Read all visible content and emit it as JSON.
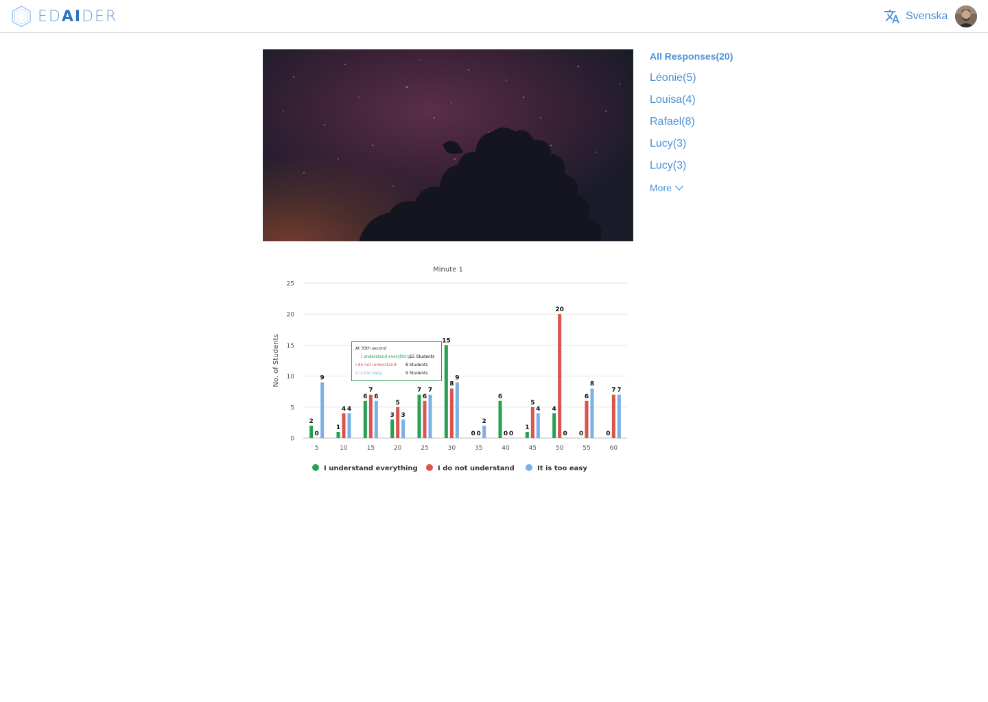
{
  "header": {
    "logo": {
      "pre": "ED",
      "ai": "AI",
      "post": "DER"
    },
    "language": "Svenska",
    "language_icon": "translate-icon",
    "avatar_icon": "user-avatar"
  },
  "sidebar": {
    "all_responses": "All Responses(20)",
    "items": [
      "Léonie(5)",
      "Louisa(4)",
      "Rafael(8)",
      "Lucy(3)",
      "Lucy(3)"
    ],
    "more": "More",
    "more_icon": "chevron-down-icon"
  },
  "colors": {
    "accent": "#4a90d9",
    "green": "#27a052",
    "red": "#d9534f",
    "blue": "#7ab0e6"
  },
  "tooltip": {
    "title": "At 30th second",
    "rows": [
      {
        "label": "I understand everything:",
        "value": "15 Students"
      },
      {
        "label": "I do not understand:",
        "value": "8 Students"
      },
      {
        "label": "It is too easy:",
        "value": "9 Students"
      }
    ]
  },
  "chart_data": {
    "type": "bar",
    "title": "Minute 1",
    "ylabel": "No. of Students",
    "xlabel": "",
    "ylim": [
      0,
      25
    ],
    "yticks": [
      0,
      5,
      10,
      15,
      20,
      25
    ],
    "categories": [
      "5",
      "10",
      "15",
      "20",
      "25",
      "30",
      "35",
      "40",
      "45",
      "50",
      "55",
      "60"
    ],
    "series": [
      {
        "name": "I understand everything",
        "color": "#27a052",
        "values": [
          2,
          1,
          6,
          3,
          7,
          15,
          0,
          6,
          1,
          4,
          null,
          null
        ]
      },
      {
        "name": "I do not understand",
        "color": "#d9534f",
        "values": [
          0,
          4,
          7,
          5,
          6,
          8,
          0,
          0,
          5,
          20,
          6,
          7
        ]
      },
      {
        "name": "It is too easy",
        "color": "#7ab0e6",
        "values": [
          9,
          4,
          6,
          3,
          7,
          9,
          2,
          0,
          4,
          0,
          8,
          7
        ]
      }
    ],
    "extra_labels": [
      {
        "category": "55",
        "series": 0,
        "text": "0"
      },
      {
        "category": "60",
        "series": 0,
        "text": "0"
      }
    ],
    "grid": true,
    "legend": "bottom-center"
  }
}
